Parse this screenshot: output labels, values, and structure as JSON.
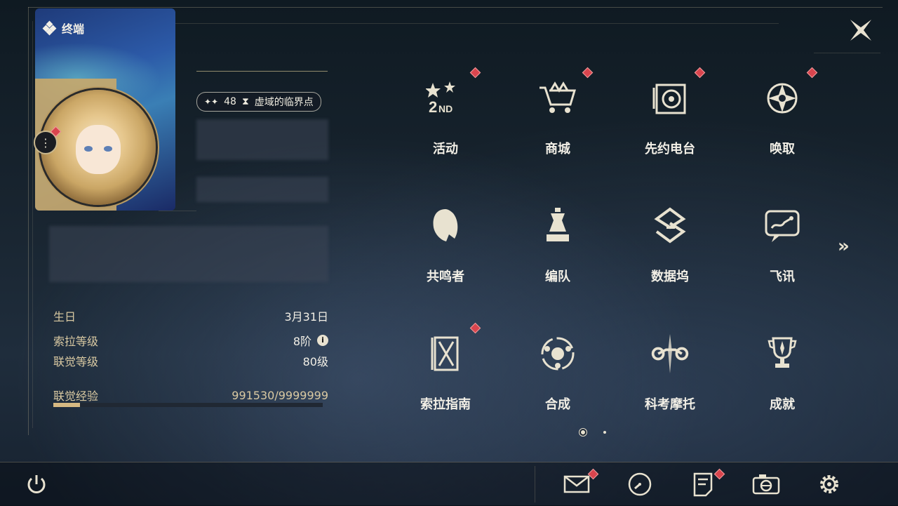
{
  "header": {
    "title": "终端"
  },
  "profile": {
    "level_prefix": "✦✦",
    "level": "48",
    "realm_label": "虚域的临界点"
  },
  "stats": [
    {
      "key": "生日",
      "value": "3月31日"
    },
    {
      "key": "索拉等级",
      "value": "8阶"
    },
    {
      "key": "联觉等级",
      "value": "80级"
    },
    {
      "key": "联觉经验",
      "value": "991530/9999999"
    }
  ],
  "xp_progress": 0.0992,
  "menu": {
    "items": [
      {
        "label": "活动",
        "icon": "event-2nd-icon",
        "badge": true
      },
      {
        "label": "商城",
        "icon": "shop-cart-icon",
        "badge": true
      },
      {
        "label": "先约电台",
        "icon": "radio-icon",
        "badge": true
      },
      {
        "label": "唤取",
        "icon": "summon-icon",
        "badge": true
      },
      {
        "label": "共鸣者",
        "icon": "resonator-icon",
        "badge": false
      },
      {
        "label": "编队",
        "icon": "team-chess-icon",
        "badge": false
      },
      {
        "label": "数据坞",
        "icon": "data-bank-icon",
        "badge": false
      },
      {
        "label": "飞讯",
        "icon": "message-icon",
        "badge": false
      },
      {
        "label": "索拉指南",
        "icon": "guide-icon",
        "badge": true
      },
      {
        "label": "合成",
        "icon": "synthesis-icon",
        "badge": false
      },
      {
        "label": "科考摩托",
        "icon": "motorcycle-icon",
        "badge": false
      },
      {
        "label": "成就",
        "icon": "trophy-icon",
        "badge": false
      }
    ],
    "next_glyph": "»"
  },
  "pager": {
    "current": 1,
    "total": 2
  },
  "colors": {
    "accent_gold": "#d6b982",
    "badge_red": "#d9454e"
  }
}
